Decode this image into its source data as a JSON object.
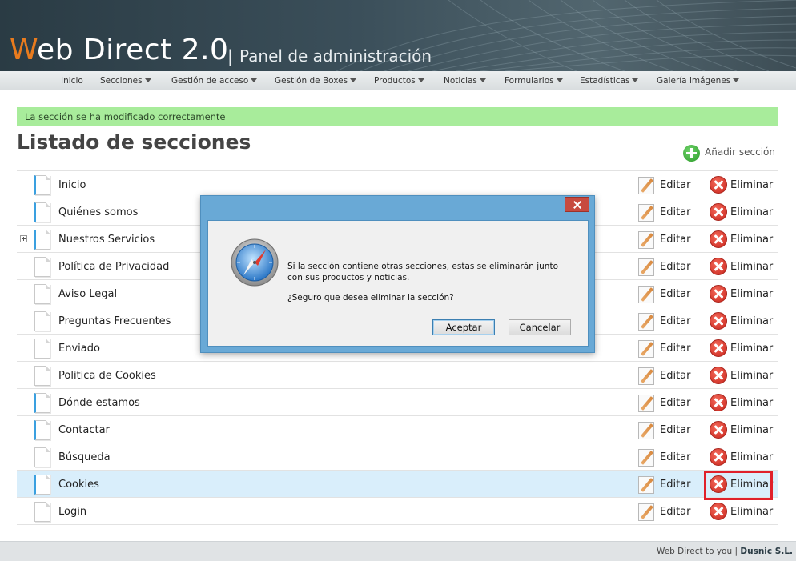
{
  "header": {
    "logo_first": "W",
    "logo_rest": "eb Direct 2.0",
    "separator": "|",
    "subtitle": "Panel de administración"
  },
  "nav": {
    "items": [
      {
        "label": "Inicio",
        "dropdown": false
      },
      {
        "label": "Secciones",
        "dropdown": true
      },
      {
        "label": "Gestión de acceso",
        "dropdown": true
      },
      {
        "label": "Gestión de Boxes",
        "dropdown": true
      },
      {
        "label": "Productos",
        "dropdown": true
      },
      {
        "label": "Noticias",
        "dropdown": true
      },
      {
        "label": "Formularios",
        "dropdown": true
      },
      {
        "label": "Estadísticas",
        "dropdown": true
      },
      {
        "label": "Galería imágenes",
        "dropdown": true
      }
    ]
  },
  "main": {
    "success_message": "La sección se ha modificado correctamente",
    "title": "Listado de secciones",
    "add_label": "Añadir sección",
    "edit_label": "Editar",
    "delete_label": "Eliminar",
    "rows": [
      {
        "label": "Inicio",
        "doc": "blue",
        "expandable": false,
        "selected": false
      },
      {
        "label": "Quiénes somos",
        "doc": "blue",
        "expandable": false,
        "selected": false
      },
      {
        "label": "Nuestros Servicios",
        "doc": "blue",
        "expandable": true,
        "selected": false
      },
      {
        "label": "Política de Privacidad",
        "doc": "plain",
        "expandable": false,
        "selected": false
      },
      {
        "label": "Aviso Legal",
        "doc": "plain",
        "expandable": false,
        "selected": false
      },
      {
        "label": "Preguntas Frecuentes",
        "doc": "plain",
        "expandable": false,
        "selected": false
      },
      {
        "label": "Enviado",
        "doc": "plain",
        "expandable": false,
        "selected": false
      },
      {
        "label": "Politica de Cookies",
        "doc": "plain",
        "expandable": false,
        "selected": false
      },
      {
        "label": "Dónde estamos",
        "doc": "blue",
        "expandable": false,
        "selected": false
      },
      {
        "label": "Contactar",
        "doc": "blue",
        "expandable": false,
        "selected": false
      },
      {
        "label": "Búsqueda",
        "doc": "plain",
        "expandable": false,
        "selected": false
      },
      {
        "label": "Cookies",
        "doc": "blue",
        "expandable": false,
        "selected": true
      },
      {
        "label": "Login",
        "doc": "plain",
        "expandable": false,
        "selected": false
      }
    ]
  },
  "dialog": {
    "message_line1": "Si la sección contiene otras secciones, estas se eliminarán junto con sus productos y noticias.",
    "message_line2": "¿Seguro que desea eliminar la sección?",
    "ok_label": "Aceptar",
    "cancel_label": "Cancelar"
  },
  "footer": {
    "text": "Web Direct to you",
    "separator": "|",
    "brand": "Dusnic S.L."
  },
  "colors": {
    "accent_orange": "#e87b1e",
    "success_bg": "#a8ec9b",
    "selected_row": "#d9eefb",
    "highlight_box": "#e0202a"
  }
}
